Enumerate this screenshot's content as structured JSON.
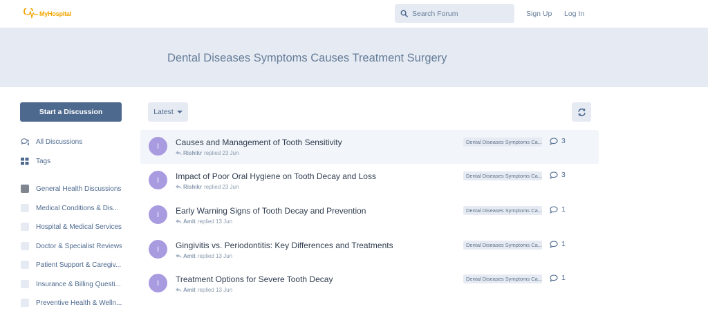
{
  "header": {
    "logo_text": "MyHospital",
    "search": {
      "placeholder": "Search Forum"
    },
    "sign_up": "Sign Up",
    "log_in": "Log In"
  },
  "hero": {
    "title": "Dental Diseases Symptoms Causes Treatment Surgery"
  },
  "sidebar": {
    "start_button": "Start a Discussion",
    "nav": [
      {
        "label": "All Discussions",
        "icon": "comments-icon"
      },
      {
        "label": "Tags",
        "icon": "tags-grid-icon"
      }
    ],
    "tags": [
      {
        "label": "General Health Discussions",
        "color": "#7f868f"
      },
      {
        "label": "Medical Conditions & Dis...",
        "color": "#e6ebf3"
      },
      {
        "label": "Hospital & Medical Services",
        "color": "#e6ebf3"
      },
      {
        "label": "Doctor & Specialist Reviews",
        "color": "#e6ebf3"
      },
      {
        "label": "Patient Support & Caregiv...",
        "color": "#e6ebf3"
      },
      {
        "label": "Insurance & Billing Questi...",
        "color": "#e6ebf3"
      },
      {
        "label": "Preventive Health & Welln...",
        "color": "#e6ebf3"
      }
    ]
  },
  "toolbar": {
    "sort_label": "Latest",
    "refresh_icon": "refresh-icon"
  },
  "discussions": [
    {
      "avatar": "I",
      "title": "Causes and Management of Tooth Sensitivity",
      "user": "Rishikr",
      "action": "replied 23 Jun",
      "tag": "Dental Diseases Symptoms Ca...",
      "replies": "3"
    },
    {
      "avatar": "I",
      "title": "Impact of Poor Oral Hygiene on Tooth Decay and Loss",
      "user": "Rishikr",
      "action": "replied 23 Jun",
      "tag": "Dental Diseases Symptoms Ca...",
      "replies": "3"
    },
    {
      "avatar": "I",
      "title": "Early Warning Signs of Tooth Decay and Prevention",
      "user": "Amit",
      "action": "replied 13 Jun",
      "tag": "Dental Diseases Symptoms Ca...",
      "replies": "1"
    },
    {
      "avatar": "I",
      "title": "Gingivitis vs. Periodontitis: Key Differences and Treatments",
      "user": "Amit",
      "action": "replied 13 Jun",
      "tag": "Dental Diseases Symptoms Ca...",
      "replies": "1"
    },
    {
      "avatar": "I",
      "title": "Treatment Options for Severe Tooth Decay",
      "user": "Amit",
      "action": "replied 13 Jun",
      "tag": "Dental Diseases Symptoms Ca...",
      "replies": "1"
    }
  ],
  "colors": {
    "accent": "#4d698e",
    "hero_bg": "#e6ebf3",
    "avatar_bg": "#a99be0",
    "logo": "#f0a500"
  }
}
